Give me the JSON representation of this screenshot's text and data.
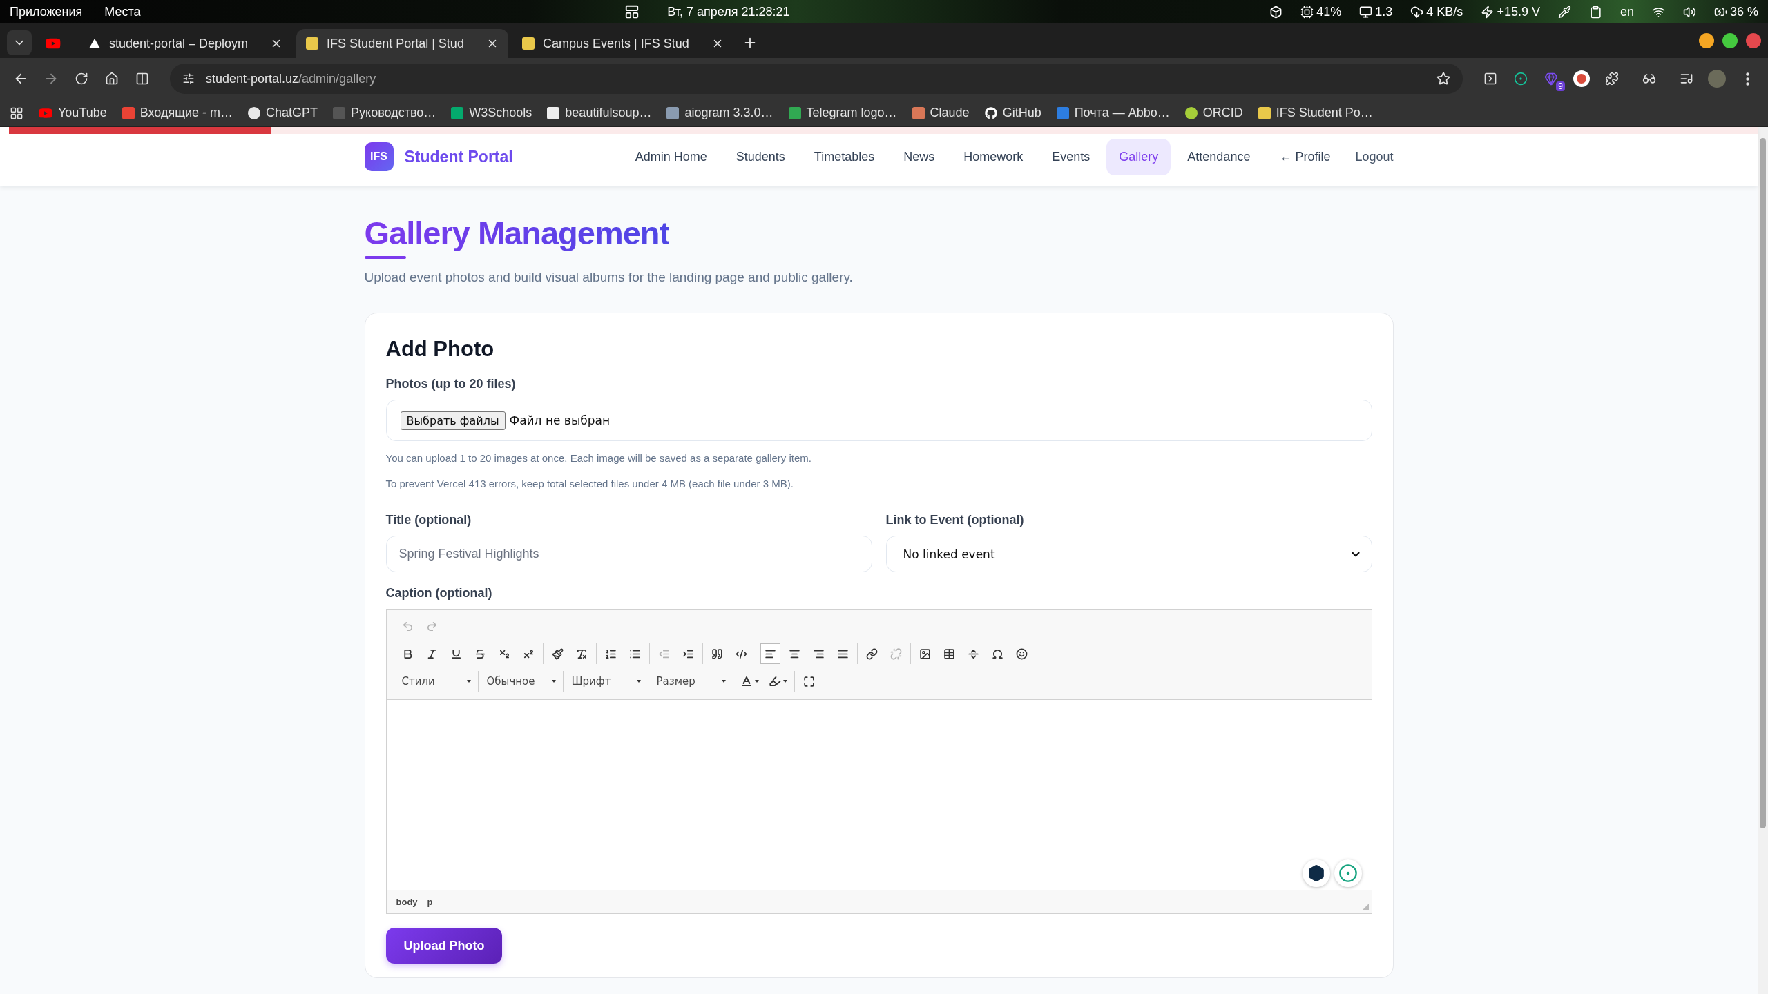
{
  "system_bar": {
    "menus": [
      "Приложения",
      "Места"
    ],
    "clock": "Вт, 7 апреля  21:28:21",
    "indicators": [
      {
        "kind": "dropbox"
      },
      {
        "kind": "cpu",
        "text": "41%"
      },
      {
        "kind": "display",
        "text": "1.3"
      },
      {
        "kind": "network",
        "text": "4 KB/s"
      },
      {
        "kind": "power",
        "text": "+15.9 V"
      },
      {
        "kind": "picker"
      },
      {
        "kind": "clipboard"
      },
      {
        "kind": "lang",
        "text": "en"
      },
      {
        "kind": "wifi"
      },
      {
        "kind": "volume"
      },
      {
        "kind": "battery",
        "text": "36 %"
      }
    ]
  },
  "browser": {
    "tabs": [
      {
        "kind": "vercel",
        "title": "student-portal – Deploym",
        "selected": false
      },
      {
        "kind": "ifs",
        "title": "IFS Student Portal | Stud",
        "selected": true
      },
      {
        "kind": "ifs",
        "title": "Campus Events | IFS Stud",
        "selected": false
      }
    ],
    "url": {
      "host": "student-portal.uz",
      "path": "/admin/gallery"
    },
    "extension_badge": "9",
    "bookmarks": [
      {
        "kind": "youtube",
        "label": "YouTube"
      },
      {
        "kind": "gmail",
        "label": "Входящие - m…"
      },
      {
        "kind": "chatgpt",
        "label": "ChatGPT"
      },
      {
        "kind": "doc",
        "label": "Руководство…"
      },
      {
        "kind": "w3",
        "label": "W3Schools"
      },
      {
        "kind": "cube",
        "label": "beautifulsoup…"
      },
      {
        "kind": "aiogram",
        "label": "aiogram 3.3.0…"
      },
      {
        "kind": "telegram",
        "label": "Telegram logo…"
      },
      {
        "kind": "claude",
        "label": "Claude"
      },
      {
        "kind": "github",
        "label": "GitHub"
      },
      {
        "kind": "mail",
        "label": "Почта — Abbo…"
      },
      {
        "kind": "orcid",
        "label": "ORCID"
      },
      {
        "kind": "ifs",
        "label": "IFS Student Po…"
      }
    ]
  },
  "loading_bar": {
    "level": 0.15
  },
  "nav": {
    "badge": "IFS",
    "brand": "Student Portal",
    "links": [
      {
        "label": "Admin Home",
        "selected": false
      },
      {
        "label": "Students",
        "selected": false
      },
      {
        "label": "Timetables",
        "selected": false
      },
      {
        "label": "News",
        "selected": false
      },
      {
        "label": "Homework",
        "selected": false
      },
      {
        "label": "Events",
        "selected": false
      },
      {
        "label": "Gallery",
        "selected": true
      },
      {
        "label": "Attendance",
        "selected": false
      },
      {
        "label": "← Profile",
        "selected": false
      }
    ],
    "logout": "Logout"
  },
  "page": {
    "title": "Gallery Management",
    "subtitle": "Upload event photos and build visual albums for the landing page and public gallery."
  },
  "form": {
    "heading": "Add Photo",
    "photos": {
      "label": "Photos (up to 20 files)",
      "button": "Выбрать файлы",
      "status": "Файл не выбран",
      "hints": [
        "You can upload 1 to 20 images at once. Each image will be saved as a separate gallery item.",
        "To prevent Vercel 413 errors, keep total selected files under 4 MB (each file under 3 MB)."
      ]
    },
    "title": {
      "label": "Title (optional)",
      "placeholder": "Spring Festival Highlights"
    },
    "event": {
      "label": "Link to Event (optional)",
      "value": "No linked event"
    },
    "caption": {
      "label": "Caption (optional)",
      "toolbar": [
        [
          [
            {
              "kind": "undo",
              "disabled": true,
              "active": false
            },
            {
              "kind": "redo",
              "disabled": true,
              "active": false
            }
          ]
        ],
        [
          [
            {
              "kind": "bold",
              "disabled": false,
              "active": false
            },
            {
              "kind": "italic",
              "disabled": false,
              "active": false
            },
            {
              "kind": "underline",
              "disabled": false,
              "active": false
            },
            {
              "kind": "strike",
              "disabled": false,
              "active": false
            },
            {
              "kind": "subscript",
              "disabled": false,
              "active": false
            },
            {
              "kind": "superscript",
              "disabled": false,
              "active": false
            }
          ],
          [
            {
              "kind": "brush",
              "disabled": false,
              "active": false
            },
            {
              "kind": "clear",
              "disabled": false,
              "active": false
            }
          ],
          [
            {
              "kind": "numbered",
              "disabled": false,
              "active": false
            },
            {
              "kind": "bulleted",
              "disabled": false,
              "active": false
            }
          ],
          [
            {
              "kind": "outdent",
              "disabled": true,
              "active": false
            },
            {
              "kind": "indent",
              "disabled": false,
              "active": false
            }
          ],
          [
            {
              "kind": "quote",
              "disabled": false,
              "active": false
            },
            {
              "kind": "div",
              "disabled": false,
              "active": false
            }
          ],
          [
            {
              "kind": "left",
              "disabled": false,
              "active": true
            },
            {
              "kind": "center",
              "disabled": false,
              "active": false
            },
            {
              "kind": "right",
              "disabled": false,
              "active": false
            },
            {
              "kind": "justify",
              "disabled": false,
              "active": false
            }
          ],
          [
            {
              "kind": "link",
              "disabled": false,
              "active": false
            },
            {
              "kind": "unlink",
              "disabled": true,
              "active": false
            }
          ],
          [
            {
              "kind": "image",
              "disabled": false,
              "active": false
            },
            {
              "kind": "table",
              "disabled": false,
              "active": false
            },
            {
              "kind": "rule",
              "disabled": false,
              "active": false
            },
            {
              "kind": "symbol",
              "disabled": false,
              "active": false
            },
            {
              "kind": "smiley",
              "disabled": false,
              "active": false
            }
          ]
        ],
        [
          [
            {
              "kind": "combo",
              "label": "Стили"
            }
          ],
          [
            {
              "kind": "combo",
              "label": "Обычное"
            }
          ],
          [
            {
              "kind": "combo",
              "label": "Шрифт"
            }
          ],
          [
            {
              "kind": "combo",
              "label": "Размер"
            }
          ],
          [
            {
              "kind": "textcolor"
            },
            {
              "kind": "bgcolor"
            }
          ],
          [
            {
              "kind": "maximize"
            }
          ]
        ]
      ],
      "path": [
        "body",
        "p"
      ]
    },
    "submit": "Upload Photo"
  }
}
